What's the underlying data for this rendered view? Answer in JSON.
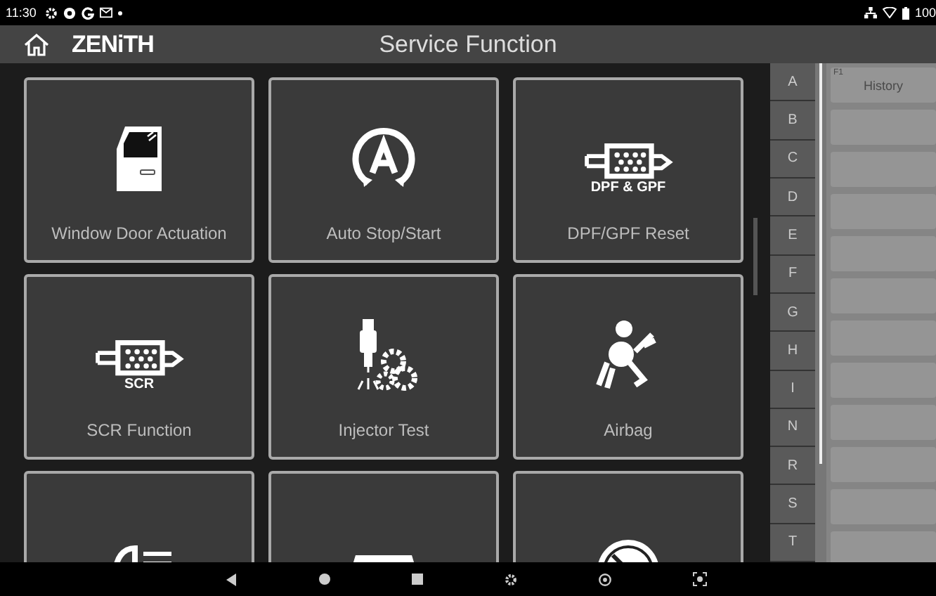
{
  "status_bar": {
    "time": "11:30",
    "battery": "100"
  },
  "header": {
    "brand": "ZENiTH",
    "title": "Service Function"
  },
  "tiles": [
    {
      "kind": "door",
      "label": "Window Door Actuation"
    },
    {
      "kind": "autostart",
      "label": "Auto Stop/Start"
    },
    {
      "kind": "filter",
      "label": "DPF/GPF Reset",
      "icon_text": "DPF & GPF"
    },
    {
      "kind": "filter",
      "label": "SCR Function",
      "icon_text": "SCR"
    },
    {
      "kind": "injector",
      "label": "Injector Test"
    },
    {
      "kind": "airbag",
      "label": "Airbag"
    },
    {
      "kind": "headlight"
    },
    {
      "kind": "windshield"
    },
    {
      "kind": "gauge"
    }
  ],
  "index_letters": [
    "A",
    "B",
    "C",
    "D",
    "E",
    "F",
    "G",
    "H",
    "I",
    "N",
    "R",
    "S",
    "T"
  ],
  "history": {
    "key": "F1",
    "title": "History"
  }
}
